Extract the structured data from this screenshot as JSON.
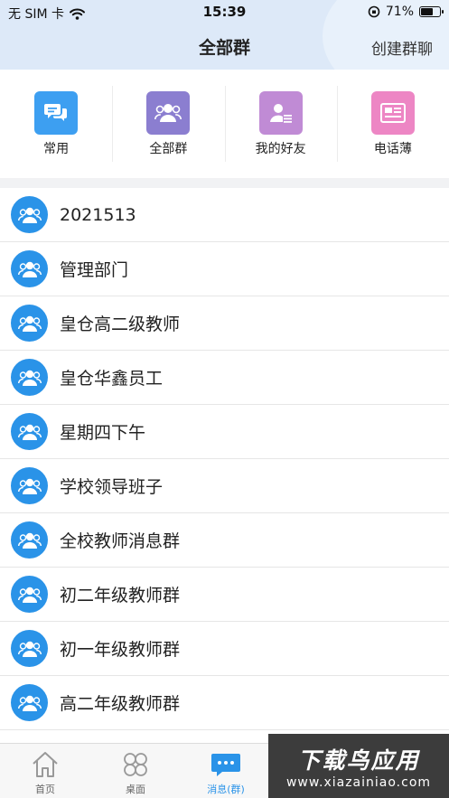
{
  "status": {
    "carrier": "无 SIM 卡",
    "time": "15:39",
    "battery": "71%",
    "battery_level": 0.71
  },
  "nav": {
    "title": "全部群",
    "action": "创建群聊"
  },
  "quick": [
    {
      "label": "常用",
      "icon": "chat-bubbles-icon",
      "color": "#3d9ff1"
    },
    {
      "label": "全部群",
      "icon": "group-icon",
      "color": "#8b7ed0"
    },
    {
      "label": "我的好友",
      "icon": "friend-list-icon",
      "color": "#c08bd5"
    },
    {
      "label": "电话薄",
      "icon": "contact-card-icon",
      "color": "#ed86c4"
    }
  ],
  "groups": [
    "2021513",
    "管理部门",
    "皇仓高二级教师",
    "皇仓华鑫员工",
    "星期四下午",
    "学校领导班子",
    "全校教师消息群",
    "初二年级教师群",
    "初一年级教师群",
    "高二年级教师群"
  ],
  "tabs": [
    {
      "label": "首页",
      "icon": "home-icon",
      "active": false
    },
    {
      "label": "桌面",
      "icon": "clover-icon",
      "active": false
    },
    {
      "label": "消息(群)",
      "icon": "message-icon",
      "active": true
    }
  ],
  "watermark": {
    "main": "下载鸟应用",
    "sub": "www.xiazainiao.com"
  },
  "colors": {
    "accent": "#2a93e8",
    "header": "#dde9f8"
  }
}
